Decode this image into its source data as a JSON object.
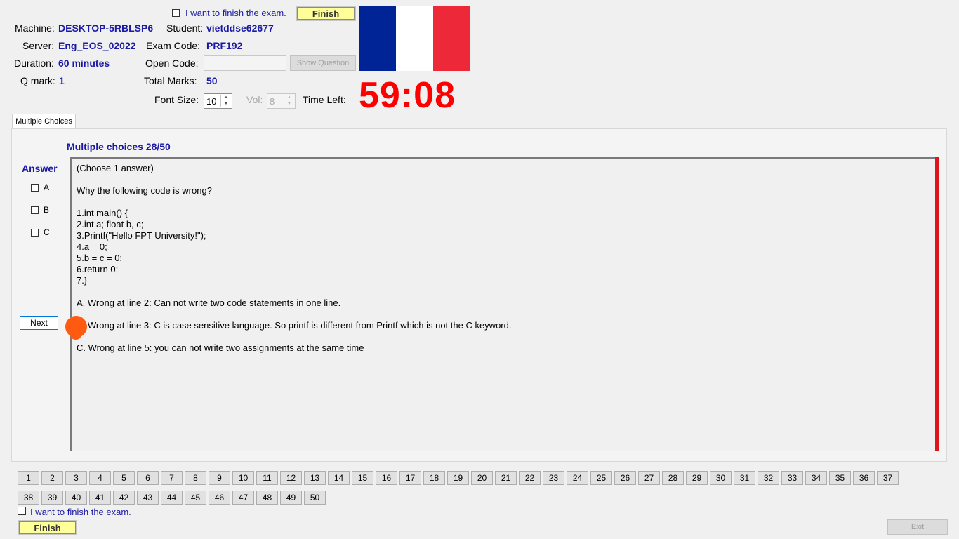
{
  "top": {
    "finish_checkbox_label": "I want to finish the exam.",
    "finish_button": "Finish",
    "machine_label": "Machine:",
    "machine_value": "DESKTOP-5RBLSP6",
    "student_label": "Student:",
    "student_value": "vietddse62677",
    "server_label": "Server:",
    "server_value": "Eng_EOS_02022",
    "exam_code_label": "Exam Code:",
    "exam_code_value": "PRF192",
    "duration_label": "Duration:",
    "duration_value": "60 minutes",
    "open_code_label": "Open Code:",
    "open_code_value": "",
    "show_question_button": "Show Question",
    "qmark_label": "Q mark:",
    "qmark_value": "1",
    "total_marks_label": "Total Marks:",
    "total_marks_value": "50",
    "font_size_label": "Font Size:",
    "font_size_value": "10",
    "vol_label": "Vol:",
    "vol_value": "8",
    "time_left_label": "Time Left:",
    "time_left_value": "59:08",
    "flag_colors": [
      "#002395",
      "#ffffff",
      "#ed2939"
    ]
  },
  "tab": {
    "label": "Multiple Choices"
  },
  "question": {
    "header": "Multiple choices 28/50",
    "answer_label": "Answer",
    "options": [
      "A",
      "B",
      "C"
    ],
    "next_button": "Next",
    "lines": [
      "(Choose 1 answer)",
      "Why the following code is wrong?",
      "1.int main() {",
      "2.int a; float b, c;",
      "3.Printf(\"Hello FPT University!\");",
      "4.a = 0;",
      "5.b = c = 0;",
      "6.return 0;",
      "7.}",
      "A.  Wrong at line 2: Can not write two code statements in one line.",
      "B.  Wrong at line 3: C is case sensitive language. So printf is different from Printf which is not the C keyword.",
      "C.  Wrong at line 5: you can not write two assignments at the same time"
    ]
  },
  "questions_nav": [
    "1",
    "2",
    "3",
    "4",
    "5",
    "6",
    "7",
    "8",
    "9",
    "10",
    "11",
    "12",
    "13",
    "14",
    "15",
    "16",
    "17",
    "18",
    "19",
    "20",
    "21",
    "22",
    "23",
    "24",
    "25",
    "26",
    "27",
    "28",
    "29",
    "30",
    "31",
    "32",
    "33",
    "34",
    "35",
    "36",
    "37",
    "38",
    "39",
    "40",
    "41",
    "42",
    "43",
    "44",
    "45",
    "46",
    "47",
    "48",
    "49",
    "50"
  ],
  "bottom": {
    "finish_checkbox_label": "I want to finish the exam.",
    "finish_button": "Finish",
    "exit_button": "Exit"
  }
}
